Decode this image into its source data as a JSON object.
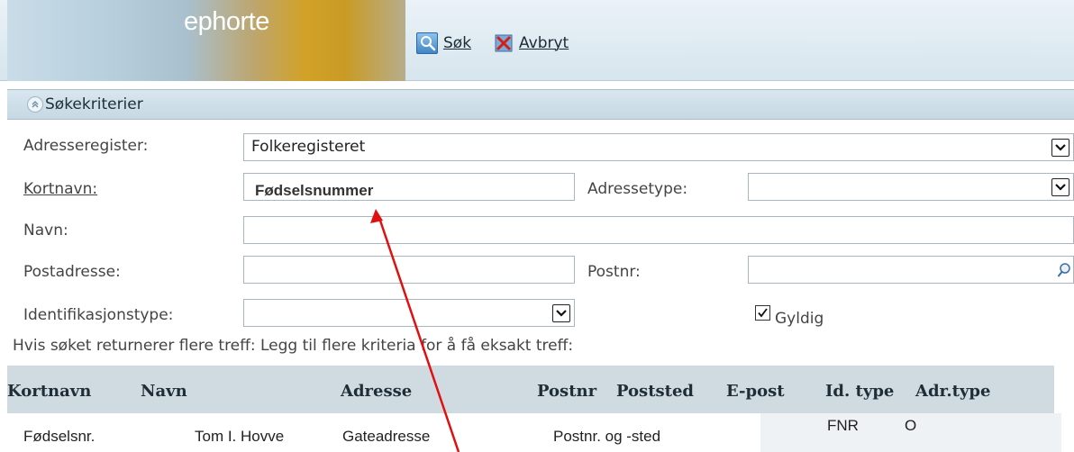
{
  "toolbar": {
    "logo_text": "ephorte",
    "search_label": "Søk",
    "cancel_label": "Avbryt"
  },
  "section": {
    "title": "Søkekriterier"
  },
  "form": {
    "adresseregister_label": "Adresseregister:",
    "adresseregister_value": "Folkeregisteret",
    "kortnavn_label": "Kortnavn:",
    "kortnavn_overlay": "Fødselsnummer",
    "adressetype_label": "Adressetype:",
    "navn_label": "Navn:",
    "postadresse_label": "Postadresse:",
    "postnr_label": "Postnr:",
    "identifikasjonstype_label": "Identifikasjonstype:",
    "gyldig_label": "Gyldig",
    "gyldig_checked": true,
    "hint": "Hvis søket returnerer flere treff: Legg til flere kriteria for å få eksakt treff:"
  },
  "results": {
    "columns": [
      "Kortnavn",
      "Navn",
      "Adresse",
      "Postnr",
      "Poststed",
      "E-post",
      "Id. type",
      "Adr.type"
    ],
    "rows": [
      {
        "kortnavn": "Fødselsnr.",
        "navn": "Tom I. Hovve",
        "adresse": "Gateadresse",
        "poststed": "Postnr. og -sted",
        "idtype": "FNR",
        "adrtype": "O"
      }
    ]
  },
  "colors": {
    "annotation_arrow": "#e01010",
    "section_header": "#c6d8e4",
    "results_header": "#cfdae1"
  }
}
